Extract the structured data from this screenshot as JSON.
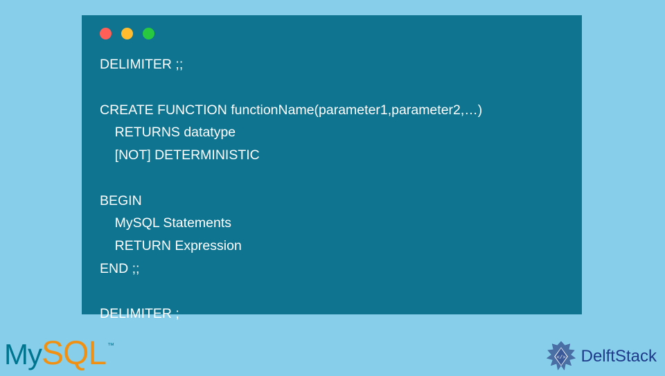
{
  "code": {
    "line1": "DELIMITER ;;",
    "line2": "",
    "line3": "CREATE FUNCTION functionName(parameter1,parameter2,…)",
    "line4": "    RETURNS datatype",
    "line5": "    [NOT] DETERMINISTIC",
    "line6": "",
    "line7": "BEGIN",
    "line8": "    MySQL Statements",
    "line9": "    RETURN Expression",
    "line10": "END ;;",
    "line11": "",
    "line12": "DELIMITER ;"
  },
  "logos": {
    "mysql_my": "My",
    "mysql_sql": "SQL",
    "mysql_tm": "™",
    "delft": "DelftStack"
  },
  "colors": {
    "bg": "#87ceeb",
    "editor": "#0e7490",
    "mysql_blue": "#00758f",
    "mysql_orange": "#f29111",
    "delft_blue": "#1e3a8a"
  }
}
